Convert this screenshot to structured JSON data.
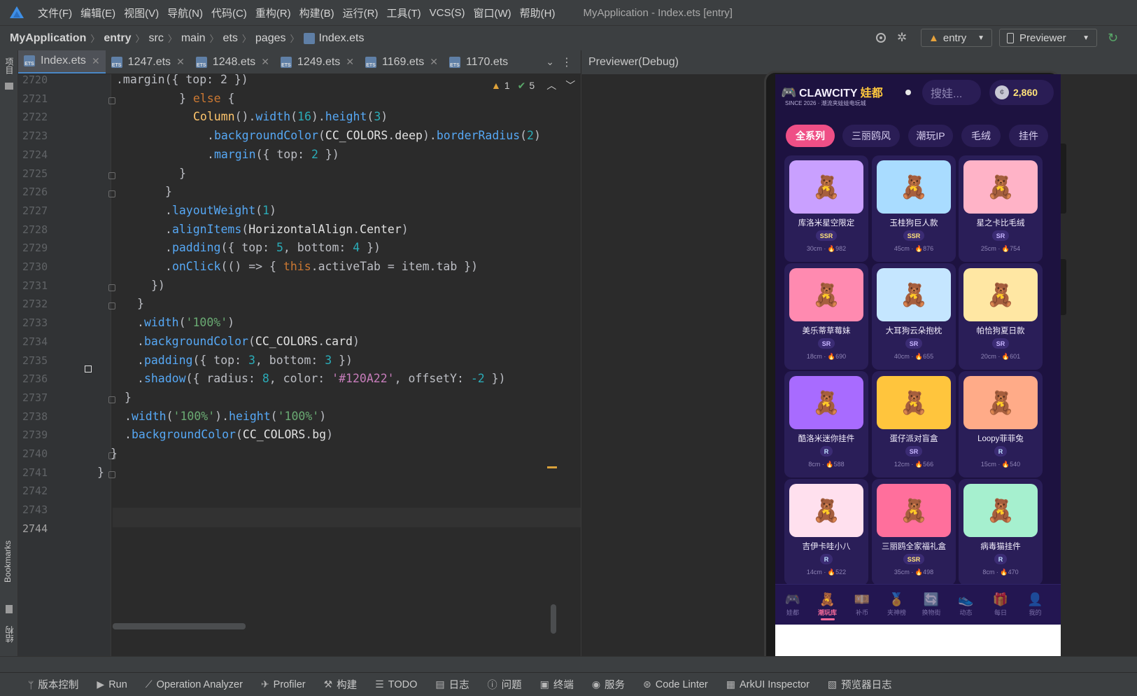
{
  "menubar": {
    "items": [
      "文件(F)",
      "编辑(E)",
      "视图(V)",
      "导航(N)",
      "代码(C)",
      "重构(R)",
      "构建(B)",
      "运行(R)",
      "工具(T)",
      "VCS(S)",
      "窗口(W)",
      "帮助(H)"
    ],
    "window_title": "MyApplication - Index.ets [entry]"
  },
  "breadcrumb": [
    "MyApplication",
    "entry",
    "src",
    "main",
    "ets",
    "pages",
    "Index.ets"
  ],
  "toolbar": {
    "module": "entry",
    "device": "Previewer"
  },
  "left_stripe": {
    "project": "项目",
    "bookmarks": "Bookmarks",
    "structure": "结构"
  },
  "tabs": [
    "Index.ets",
    "1247.ets",
    "1248.ets",
    "1249.ets",
    "1169.ets",
    "1170.ets"
  ],
  "inspections": {
    "warnings": "1",
    "ok": "5"
  },
  "editor": {
    "line_numbers": [
      "2720",
      "2721",
      "2722",
      "2723",
      "2724",
      "2725",
      "2726",
      "2727",
      "2728",
      "2729",
      "2730",
      "2731",
      "2732",
      "2733",
      "2734",
      "2735",
      "2736",
      "2737",
      "2738",
      "2739",
      "2740",
      "2741",
      "2742",
      "2743",
      "2744"
    ]
  },
  "preview": {
    "title": "Previewer(Debug)"
  },
  "app": {
    "brand": "CLAWCITY",
    "brand_suffix": "娃都",
    "tagline": "SINCE 2026 · 潮流夹娃娃电玩城",
    "search_placeholder": "搜娃...",
    "coins": "2,860",
    "filters": [
      "全系列",
      "三丽鸥风",
      "潮玩IP",
      "毛绒",
      "挂件"
    ],
    "products": [
      {
        "name": "库洛米星空限定",
        "rarity": "SSR",
        "size": "30cm",
        "heat": "982",
        "color": "#c9a0ff"
      },
      {
        "name": "玉桂狗巨人款",
        "rarity": "SSR",
        "size": "45cm",
        "heat": "876",
        "color": "#a9dcff"
      },
      {
        "name": "星之卡比毛绒",
        "rarity": "SR",
        "size": "25cm",
        "heat": "754",
        "color": "#ffb3c7"
      },
      {
        "name": "美乐蒂草莓妹",
        "rarity": "SR",
        "size": "18cm",
        "heat": "690",
        "color": "#ff8ab0"
      },
      {
        "name": "大耳狗云朵抱枕",
        "rarity": "SR",
        "size": "40cm",
        "heat": "655",
        "color": "#c5e6ff"
      },
      {
        "name": "帕恰狗夏日款",
        "rarity": "SR",
        "size": "20cm",
        "heat": "601",
        "color": "#ffe7a3"
      },
      {
        "name": "酷洛米迷你挂件",
        "rarity": "R",
        "size": "8cm",
        "heat": "588",
        "color": "#a86bff"
      },
      {
        "name": "蛋仔派对盲盒",
        "rarity": "SR",
        "size": "12cm",
        "heat": "566",
        "color": "#ffc53d"
      },
      {
        "name": "Loopy菲菲兔",
        "rarity": "R",
        "size": "15cm",
        "heat": "540",
        "color": "#ffab88"
      },
      {
        "name": "吉伊卡哇小八",
        "rarity": "R",
        "size": "14cm",
        "heat": "522",
        "color": "#ffe0ee"
      },
      {
        "name": "三丽鸥全家福礼盒",
        "rarity": "SSR",
        "size": "35cm",
        "heat": "498",
        "color": "#ff6f9c"
      },
      {
        "name": "病毒猫挂件",
        "rarity": "R",
        "size": "8cm",
        "heat": "470",
        "color": "#a6f0cf"
      }
    ],
    "bottom_nav": [
      {
        "label": "娃都",
        "icon": "🎮"
      },
      {
        "label": "潮玩库",
        "icon": "🧸"
      },
      {
        "label": "补币",
        "icon": "💴"
      },
      {
        "label": "夹神榜",
        "icon": "🏅"
      },
      {
        "label": "换物街",
        "icon": "🔄"
      },
      {
        "label": "动态",
        "icon": "👟"
      },
      {
        "label": "每日",
        "icon": "🎁"
      },
      {
        "label": "我的",
        "icon": "👤"
      }
    ],
    "active_nav": "潮玩库"
  },
  "statusbar": [
    {
      "label": "版本控制",
      "icon": "branch-icon"
    },
    {
      "label": "Run",
      "icon": "run-icon"
    },
    {
      "label": "Operation Analyzer",
      "icon": "chart-icon"
    },
    {
      "label": "Profiler",
      "icon": "profiler-icon"
    },
    {
      "label": "构建",
      "icon": "hammer-icon"
    },
    {
      "label": "TODO",
      "icon": "list-icon"
    },
    {
      "label": "日志",
      "icon": "log-icon"
    },
    {
      "label": "问题",
      "icon": "problems-icon"
    },
    {
      "label": "终端",
      "icon": "terminal-icon"
    },
    {
      "label": "服务",
      "icon": "services-icon"
    },
    {
      "label": "Code Linter",
      "icon": "linter-icon"
    },
    {
      "label": "ArkUI Inspector",
      "icon": "inspector-icon"
    },
    {
      "label": "预览器日志",
      "icon": "preview-log-icon"
    }
  ]
}
